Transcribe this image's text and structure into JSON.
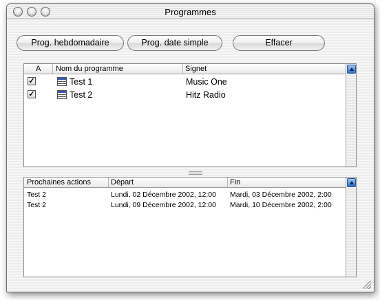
{
  "window": {
    "title": "Programmes"
  },
  "toolbar": {
    "weekly_label": "Prog. hebdomadaire",
    "single_date_label": "Prog. date simple",
    "clear_label": "Effacer"
  },
  "programs_table": {
    "columns": {
      "active": "A",
      "name": "Nom du programme",
      "bookmark": "Signet"
    },
    "rows": [
      {
        "checked": true,
        "check_glyph": "✓",
        "name": "Test 1",
        "bookmark": "Music One"
      },
      {
        "checked": true,
        "check_glyph": "✓",
        "name": "Test 2",
        "bookmark": "Hitz Radio"
      }
    ]
  },
  "actions_table": {
    "columns": {
      "action": "Prochaines actions",
      "start": "Départ",
      "end": "Fin"
    },
    "rows": [
      {
        "action": "Test 2",
        "start": "Lundi, 02 Décembre 2002, 12:00",
        "end": "Mardi, 03 Décembre 2002, 2:00"
      },
      {
        "action": "Test 2",
        "start": "Lundi, 09 Décembre 2002, 12:00",
        "end": "Mardi, 10 Décembre 2002, 2:00"
      }
    ]
  },
  "icons": [
    "close-icon",
    "minimize-icon",
    "zoom-icon",
    "calendar-icon",
    "sort-arrow-icon",
    "resize-grip-icon"
  ],
  "colors": {
    "accent_blue": "#3a78d0",
    "header_bg": "#e9e9e9",
    "stripe_light": "#f7f7f7",
    "stripe_dark": "#ececec"
  }
}
